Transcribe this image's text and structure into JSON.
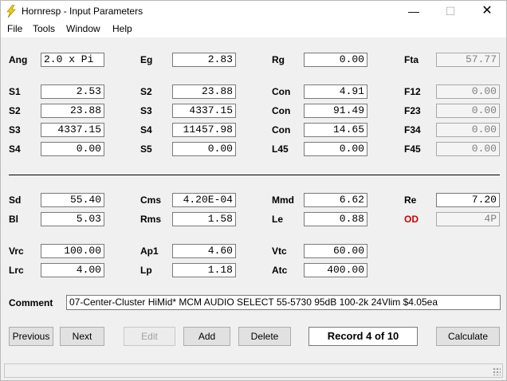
{
  "window": {
    "title": "Hornresp - Input Parameters",
    "min_glyph": "—",
    "max_glyph": "☐",
    "close_glyph": "✕"
  },
  "menu": [
    "File",
    "Tools",
    "Window",
    "Help"
  ],
  "params": {
    "ang": {
      "label": "Ang",
      "value": "2.0 x Pi"
    },
    "eg": {
      "label": "Eg",
      "value": "2.83"
    },
    "rg": {
      "label": "Rg",
      "value": "0.00"
    },
    "fta": {
      "label": "Fta",
      "value": "57.77"
    },
    "s1": {
      "label": "S1",
      "value": "2.53"
    },
    "s2a": {
      "label": "S2",
      "value": "23.88"
    },
    "con1": {
      "label": "Con",
      "value": "4.91"
    },
    "f12": {
      "label": "F12",
      "value": "0.00"
    },
    "s2b": {
      "label": "S2",
      "value": "23.88"
    },
    "s3a": {
      "label": "S3",
      "value": "4337.15"
    },
    "con2": {
      "label": "Con",
      "value": "91.49"
    },
    "f23": {
      "label": "F23",
      "value": "0.00"
    },
    "s3b": {
      "label": "S3",
      "value": "4337.15"
    },
    "s4a": {
      "label": "S4",
      "value": "11457.98"
    },
    "con3": {
      "label": "Con",
      "value": "14.65"
    },
    "f34": {
      "label": "F34",
      "value": "0.00"
    },
    "s4b": {
      "label": "S4",
      "value": "0.00"
    },
    "s5": {
      "label": "S5",
      "value": "0.00"
    },
    "l45": {
      "label": "L45",
      "value": "0.00"
    },
    "f45": {
      "label": "F45",
      "value": "0.00"
    },
    "sd": {
      "label": "Sd",
      "value": "55.40"
    },
    "cms": {
      "label": "Cms",
      "value": "4.20E-04"
    },
    "mmd": {
      "label": "Mmd",
      "value": "6.62"
    },
    "re": {
      "label": "Re",
      "value": "7.20"
    },
    "bl": {
      "label": "Bl",
      "value": "5.03"
    },
    "rms": {
      "label": "Rms",
      "value": "1.58"
    },
    "le": {
      "label": "Le",
      "value": "0.88"
    },
    "od": {
      "label": "OD",
      "value": "4P"
    },
    "vrc": {
      "label": "Vrc",
      "value": "100.00"
    },
    "ap1": {
      "label": "Ap1",
      "value": "4.60"
    },
    "vtc": {
      "label": "Vtc",
      "value": "60.00"
    },
    "lrc": {
      "label": "Lrc",
      "value": "4.00"
    },
    "lp": {
      "label": "Lp",
      "value": "1.18"
    },
    "atc": {
      "label": "Atc",
      "value": "400.00"
    }
  },
  "comment": {
    "label": "Comment",
    "value": "07-Center-Cluster HiMid* MCM AUDIO SELECT 55-5730 95dB 100-2k 24Vlim $4.05ea"
  },
  "buttons": {
    "previous": "Previous",
    "next": "Next",
    "edit": "Edit",
    "add": "Add",
    "delete": "Delete",
    "calculate": "Calculate"
  },
  "record": "Record 4 of 10",
  "colors": {
    "od_label": "#d00000",
    "lightning": "#f5d000"
  }
}
